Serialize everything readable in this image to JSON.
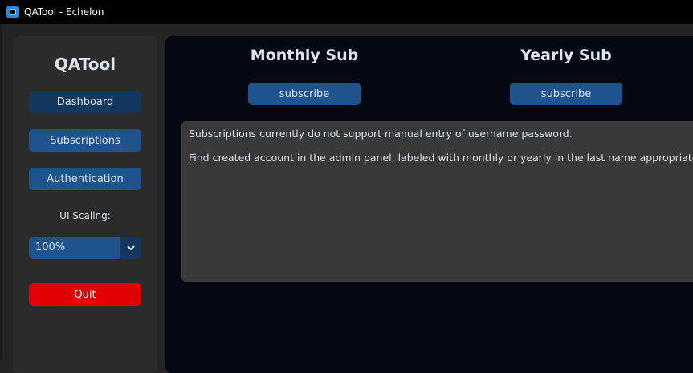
{
  "window": {
    "title": "QATool - Echelon",
    "icon": "app-icon"
  },
  "sidebar": {
    "title": "QATool",
    "nav": [
      {
        "label": "Dashboard",
        "active": true
      },
      {
        "label": "Subscriptions",
        "active": false
      },
      {
        "label": "Authentication",
        "active": false
      }
    ],
    "scaling_label": "UI Scaling:",
    "scaling_value": "100%",
    "quit_label": "Quit"
  },
  "main": {
    "plans": [
      {
        "title": "Monthly Sub",
        "button_label": "subscribe"
      },
      {
        "title": "Yearly Sub",
        "button_label": "subscribe"
      }
    ],
    "info_lines": [
      "Subscriptions currently do not support manual entry of username password.",
      "Find created account in the admin panel, labeled with monthly or yearly in the last name appropriately."
    ]
  },
  "colors": {
    "accent": "#1f538d",
    "accent_active": "#14375e",
    "quit": "#e10000",
    "main_background": "#030812",
    "sidebar_background": "#2b2b2b",
    "textbox_background": "#393939"
  }
}
